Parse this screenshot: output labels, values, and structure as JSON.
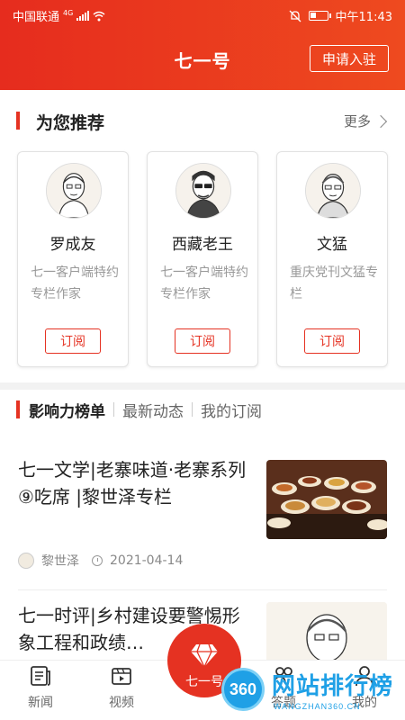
{
  "status_bar": {
    "carrier": "中国联通",
    "network": "4G",
    "time": "中午11:43"
  },
  "header": {
    "title": "七一号",
    "apply_label": "申请入驻"
  },
  "recommend": {
    "title": "为您推荐",
    "more_label": "更多",
    "cards": [
      {
        "name": "罗成友",
        "desc": "七一客户端特约专栏作家",
        "subscribe_label": "订阅",
        "avatar_caption": "七一客户端特约专栏作家"
      },
      {
        "name": "西藏老王",
        "desc": "七一客户端特约专栏作家",
        "subscribe_label": "订阅",
        "avatar_caption": "西藏老王"
      },
      {
        "name": "文猛",
        "desc": "重庆党刊文猛专栏",
        "subscribe_label": "订阅",
        "avatar_caption": "七一客户端特约专栏作家"
      }
    ]
  },
  "tabs": [
    {
      "label": "影响力榜单",
      "active": true
    },
    {
      "label": "最新动态",
      "active": false
    },
    {
      "label": "我的订阅",
      "active": false
    }
  ],
  "articles": [
    {
      "title": "七一文学|老寨味道·老寨系列⑨吃席 |黎世泽专栏",
      "author": "黎世泽",
      "date": "2021-04-14"
    },
    {
      "title": "七一时评|乡村建设要警惕形象工程和政绩…",
      "author": "",
      "date": ""
    }
  ],
  "nav": {
    "items": [
      {
        "label": "新闻",
        "icon": "news-icon"
      },
      {
        "label": "视频",
        "icon": "video-icon"
      },
      {
        "label": "七一号",
        "icon": "diamond-icon"
      },
      {
        "label": "答题",
        "icon": "quiz-icon"
      },
      {
        "label": "我的",
        "icon": "profile-icon"
      }
    ]
  },
  "watermark": {
    "badge": "360",
    "text": "网站排行榜",
    "sub": "WANGZHAN360.CN"
  },
  "colors": {
    "brand_red": "#e53222",
    "watermark_blue": "#1fa0e6"
  }
}
